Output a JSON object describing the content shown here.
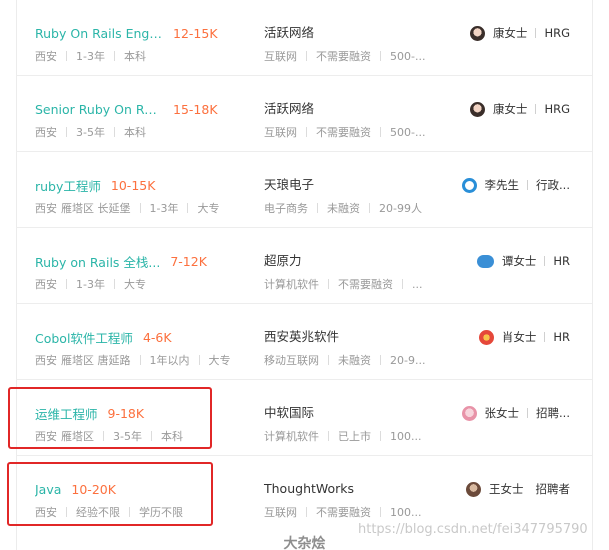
{
  "jobs": [
    {
      "title": "Ruby On Rails Engi...",
      "salary": "12-15K",
      "city": "西安",
      "district": "",
      "experience": "1-3年",
      "education": "本科",
      "company": "活跃网络",
      "industry": "互联网",
      "financing": "不需要融资",
      "size": "500-...",
      "recruiter": "康女士",
      "recruiter_role": "HRG",
      "avatar": "face"
    },
    {
      "title": "Senior Ruby On Rai...",
      "salary": "15-18K",
      "city": "西安",
      "district": "",
      "experience": "3-5年",
      "education": "本科",
      "company": "活跃网络",
      "industry": "互联网",
      "financing": "不需要融资",
      "size": "500-...",
      "recruiter": "康女士",
      "recruiter_role": "HRG",
      "avatar": "face"
    },
    {
      "title": "ruby工程师",
      "salary": "10-15K",
      "city": "西安",
      "district": "雁塔区 长延堡",
      "experience": "1-3年",
      "education": "大专",
      "company": "天琅电子",
      "industry": "电子商务",
      "financing": "未融资",
      "size": "20-99人",
      "recruiter": "李先生",
      "recruiter_role": "行政...",
      "avatar": "blue"
    },
    {
      "title": "Ruby on Rails 全栈...",
      "salary": "7-12K",
      "city": "西安",
      "district": "",
      "experience": "1-3年",
      "education": "大专",
      "company": "超原力",
      "industry": "计算机软件",
      "financing": "不需要融资",
      "size": "...",
      "recruiter": "谭女士",
      "recruiter_role": "HR",
      "avatar": "badge"
    },
    {
      "title": "Cobol软件工程师",
      "salary": "4-6K",
      "city": "西安",
      "district": "雁塔区 唐延路",
      "experience": "1年以内",
      "education": "大专",
      "company": "西安英兆软件",
      "industry": "移动互联网",
      "financing": "未融资",
      "size": "20-9...",
      "recruiter": "肖女士",
      "recruiter_role": "HR",
      "avatar": "red"
    },
    {
      "title": "运维工程师",
      "salary": "9-18K",
      "city": "西安",
      "district": "雁塔区",
      "experience": "3-5年",
      "education": "本科",
      "company": "中软国际",
      "industry": "计算机软件",
      "financing": "已上市",
      "size": "100...",
      "recruiter": "张女士",
      "recruiter_role": "招聘...",
      "avatar": "pink"
    },
    {
      "title": "Java",
      "salary": "10-20K",
      "city": "西安",
      "district": "",
      "experience": "经验不限",
      "education": "学历不限",
      "company": "ThoughtWorks",
      "industry": "互联网",
      "financing": "不需要融资",
      "size": "100...",
      "recruiter": "王女士",
      "recruiter_role": "招聘者",
      "avatar": "brown"
    }
  ],
  "caption": "大杂烩",
  "watermark": "https://blog.csdn.net/fei347795790",
  "colors": {
    "title": "#2bb5a8",
    "salary": "#fc703e",
    "highlight": "#e12727"
  }
}
